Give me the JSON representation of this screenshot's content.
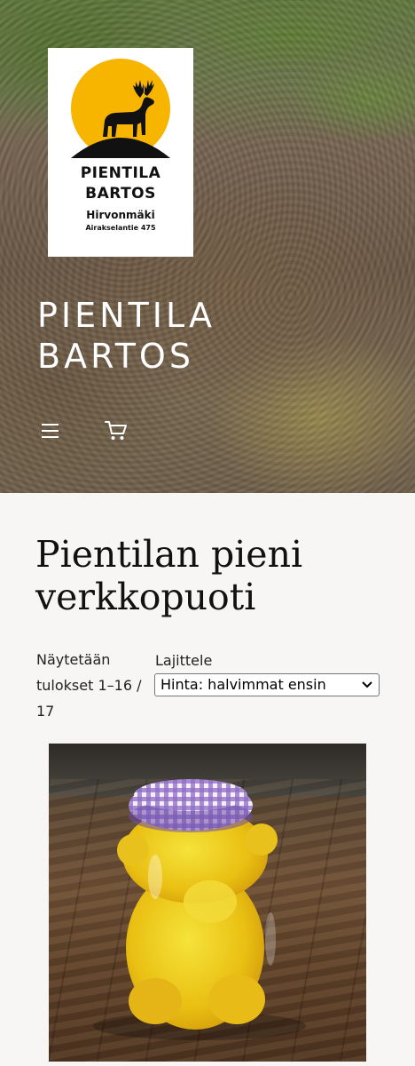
{
  "header": {
    "logo": {
      "line1": "PIENTILA",
      "line2": "BARTOS",
      "line3": "Hirvonmäki",
      "line4": "Airakselantie 475",
      "accent_color": "#f7b500"
    },
    "site_title": "PIENTILA BARTOS",
    "menu_icon": "hamburger-menu-icon",
    "cart_icon": "shopping-cart-icon"
  },
  "main": {
    "page_title": "Pientilan pieni verkkopuoti",
    "result_count": "Näytetään tulokset 1–16 / 17",
    "sort": {
      "label": "Lajittele",
      "selected": "Hinta: halvimmat ensin"
    },
    "products": [
      {
        "image": "honey-bear-jar-image"
      }
    ]
  }
}
